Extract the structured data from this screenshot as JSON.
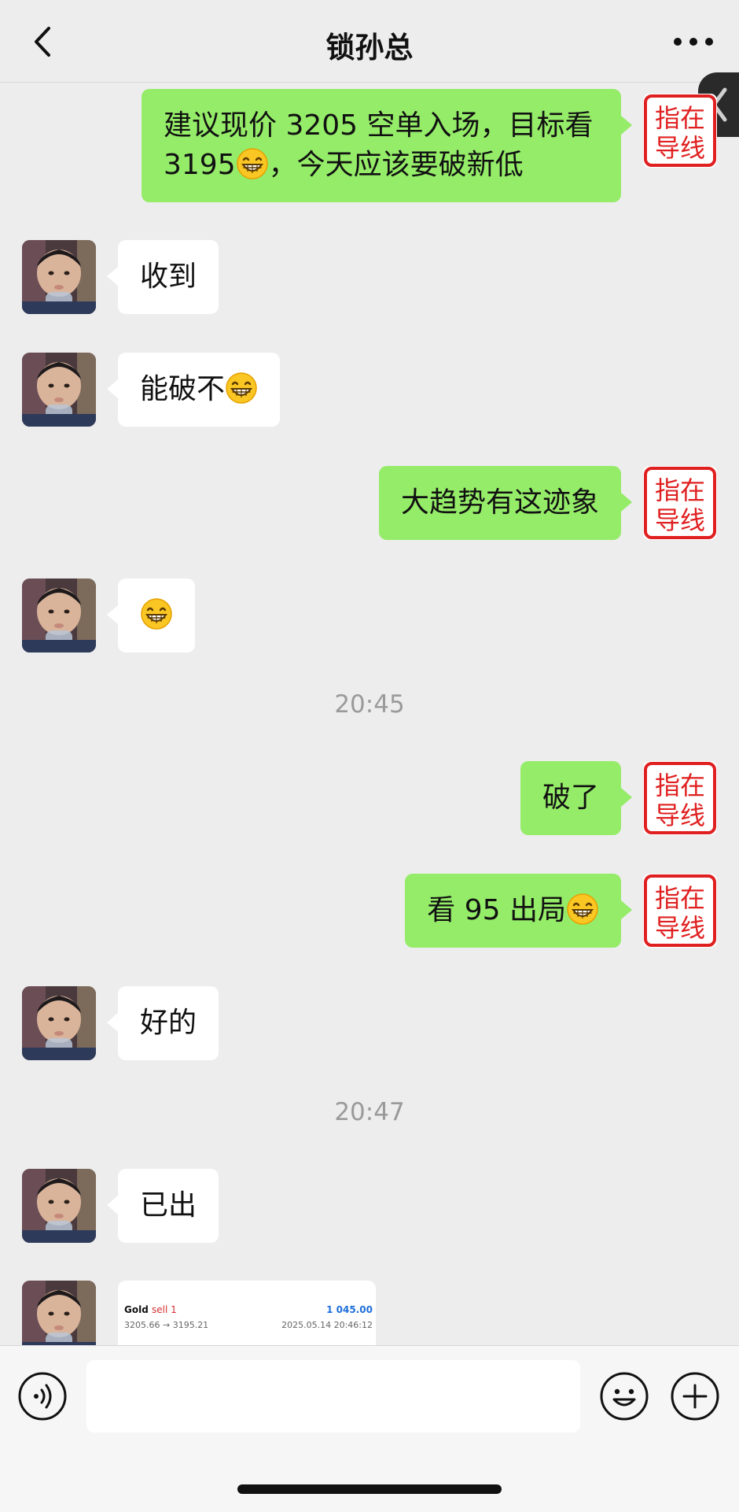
{
  "header": {
    "title": "锁孙总"
  },
  "messages": [
    {
      "side": "right",
      "text_before": "建议现价 3205 空单入场，目标看 3195",
      "emoji": "grinning-face",
      "text_after": "，今天应该要破新低"
    },
    {
      "side": "left",
      "text": "收到"
    },
    {
      "side": "left",
      "text": "能破不",
      "emoji": "grinning-face"
    },
    {
      "side": "right",
      "text": "大趋势有这迹象"
    },
    {
      "side": "left",
      "emoji": "grinning-face"
    },
    {
      "side": "right",
      "text": "破了"
    },
    {
      "side": "right",
      "text": "看 95 出局",
      "emoji": "grinning-face"
    },
    {
      "side": "left",
      "text": "好的"
    },
    {
      "side": "left",
      "text": "已出"
    }
  ],
  "timestamps": [
    "20:45",
    "20:47"
  ],
  "self_avatar": {
    "line1": "指在",
    "line2": "导线",
    "color": "#e02020"
  },
  "trade_card": {
    "symbol": "Gold",
    "direction": "sell 1",
    "profit": "1 045.00",
    "prices": "3205.66 → 3195.21",
    "datetime": "2025.05.14 20:46:12"
  },
  "colors": {
    "self_bubble": "#95ec69",
    "other_bubble": "#ffffff",
    "background": "#ededed"
  },
  "icons": {
    "back": "chevron-left-icon",
    "more": "more-dots-icon",
    "voice": "voice-icon",
    "emoji": "emoji-icon",
    "plus": "plus-icon"
  }
}
